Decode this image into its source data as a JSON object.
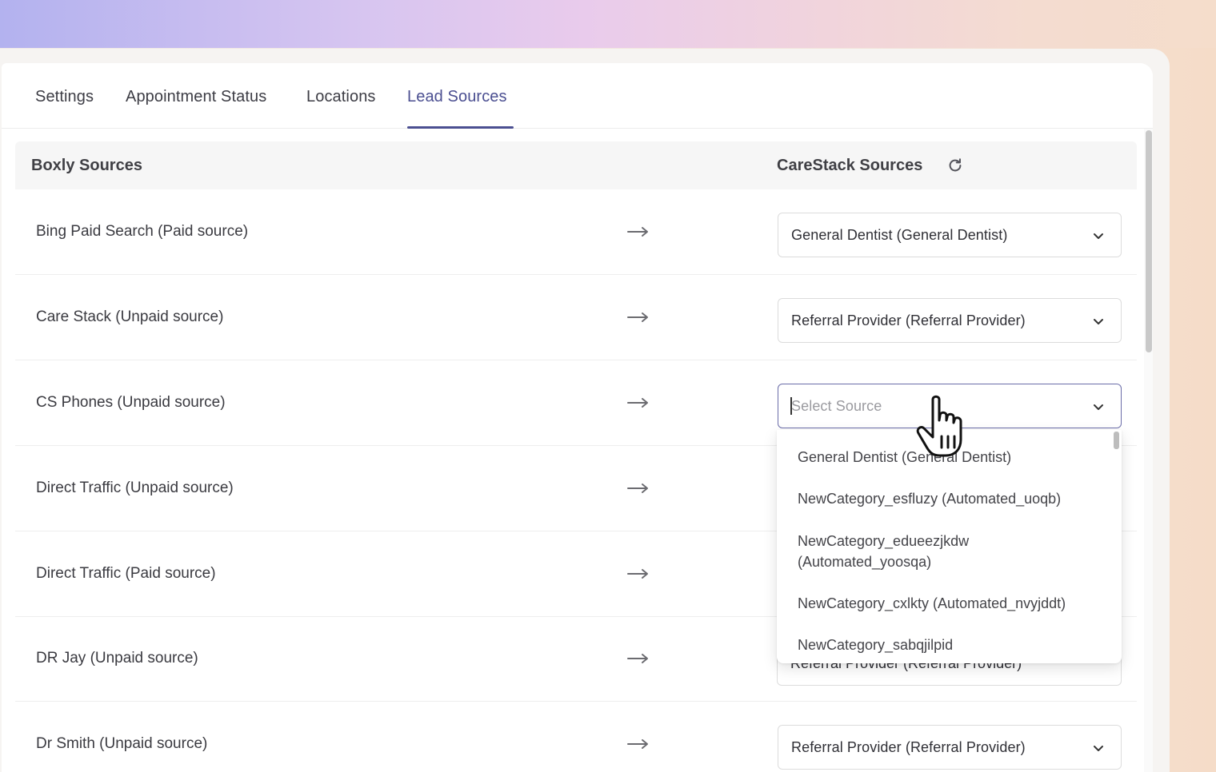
{
  "tabs": [
    {
      "label": "Settings",
      "active": false
    },
    {
      "label": "Appointment Status",
      "active": false
    },
    {
      "label": "Locations",
      "active": false
    },
    {
      "label": "Lead Sources",
      "active": true
    }
  ],
  "table": {
    "left_header": "Boxly Sources",
    "right_header": "CareStack Sources",
    "rows": [
      {
        "source": "Bing Paid Search (Paid source)",
        "mapped": "General Dentist (General Dentist)"
      },
      {
        "source": "Care Stack (Unpaid source)",
        "mapped": "Referral Provider (Referral Provider)"
      },
      {
        "source": "CS Phones (Unpaid source)",
        "mapped": ""
      },
      {
        "source": "Direct Traffic (Unpaid source)",
        "mapped": ""
      },
      {
        "source": "Direct Traffic (Paid source)",
        "mapped": ""
      },
      {
        "source": "DR Jay (Unpaid source)",
        "mapped": "Referral Provider (Referral Provider)"
      },
      {
        "source": "Dr Smith (Unpaid source)",
        "mapped": "Referral Provider (Referral Provider)"
      }
    ]
  },
  "select": {
    "placeholder": "Select Source"
  },
  "dropdown": {
    "options": [
      "General Dentist (General Dentist)",
      "NewCategory_esfluzy (Automated_uoqb)",
      "NewCategory_edueezjkdw",
      "(Automated_yoosqa)",
      "NewCategory_cxlkty (Automated_nvyjddt)",
      "NewCategory_sabqjilpid"
    ]
  },
  "colors": {
    "accent": "#4b4f91",
    "text": "#3a3a40"
  },
  "icons": {
    "refresh": "refresh-icon",
    "arrow": "arrow-right-icon",
    "chevron": "chevron-down-icon",
    "cursor": "hand-pointer-cursor"
  }
}
